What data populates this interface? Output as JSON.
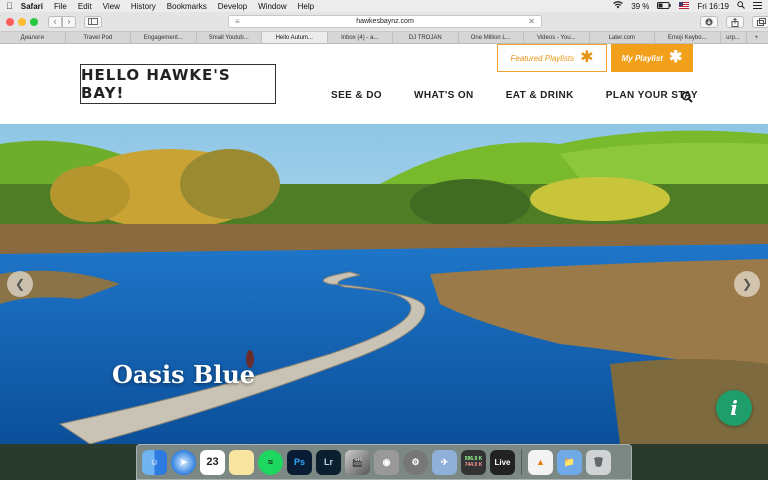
{
  "menubar": {
    "app": "Safari",
    "items": [
      "File",
      "Edit",
      "View",
      "History",
      "Bookmarks",
      "Develop",
      "Window",
      "Help"
    ],
    "battery": "39 %",
    "clock": "Fri 16:19"
  },
  "browser": {
    "url": "hawkesbaynz.com",
    "tabs": [
      "Диалоги",
      "Travel Pod",
      "Engagement...",
      "Small Youtub...",
      "Hello Autum...",
      "Inbox (4) - a...",
      "DJ TROJAN",
      "One Million L...",
      "Videos - You...",
      "Later.com",
      "Emoji Keybo...",
      "urp..."
    ],
    "active_tab": 4
  },
  "site": {
    "logo": "HELLO HAWKE'S BAY!",
    "featured_playlists": "Featured Playlists",
    "my_playlist": "My Playlist",
    "nav": [
      "SEE & DO",
      "WHAT'S ON",
      "EAT & DRINK",
      "PLAN YOUR STAY"
    ],
    "hero_caption": "Oasis Blue",
    "accent": "#f29f1c",
    "info_color": "#1f9d6b"
  },
  "dock": {
    "calendar_date": "23",
    "photoshop": "Ps",
    "lightroom": "Lr",
    "live": "Live",
    "meter_top": "596.9 K",
    "meter_bottom": "744.0 K"
  }
}
